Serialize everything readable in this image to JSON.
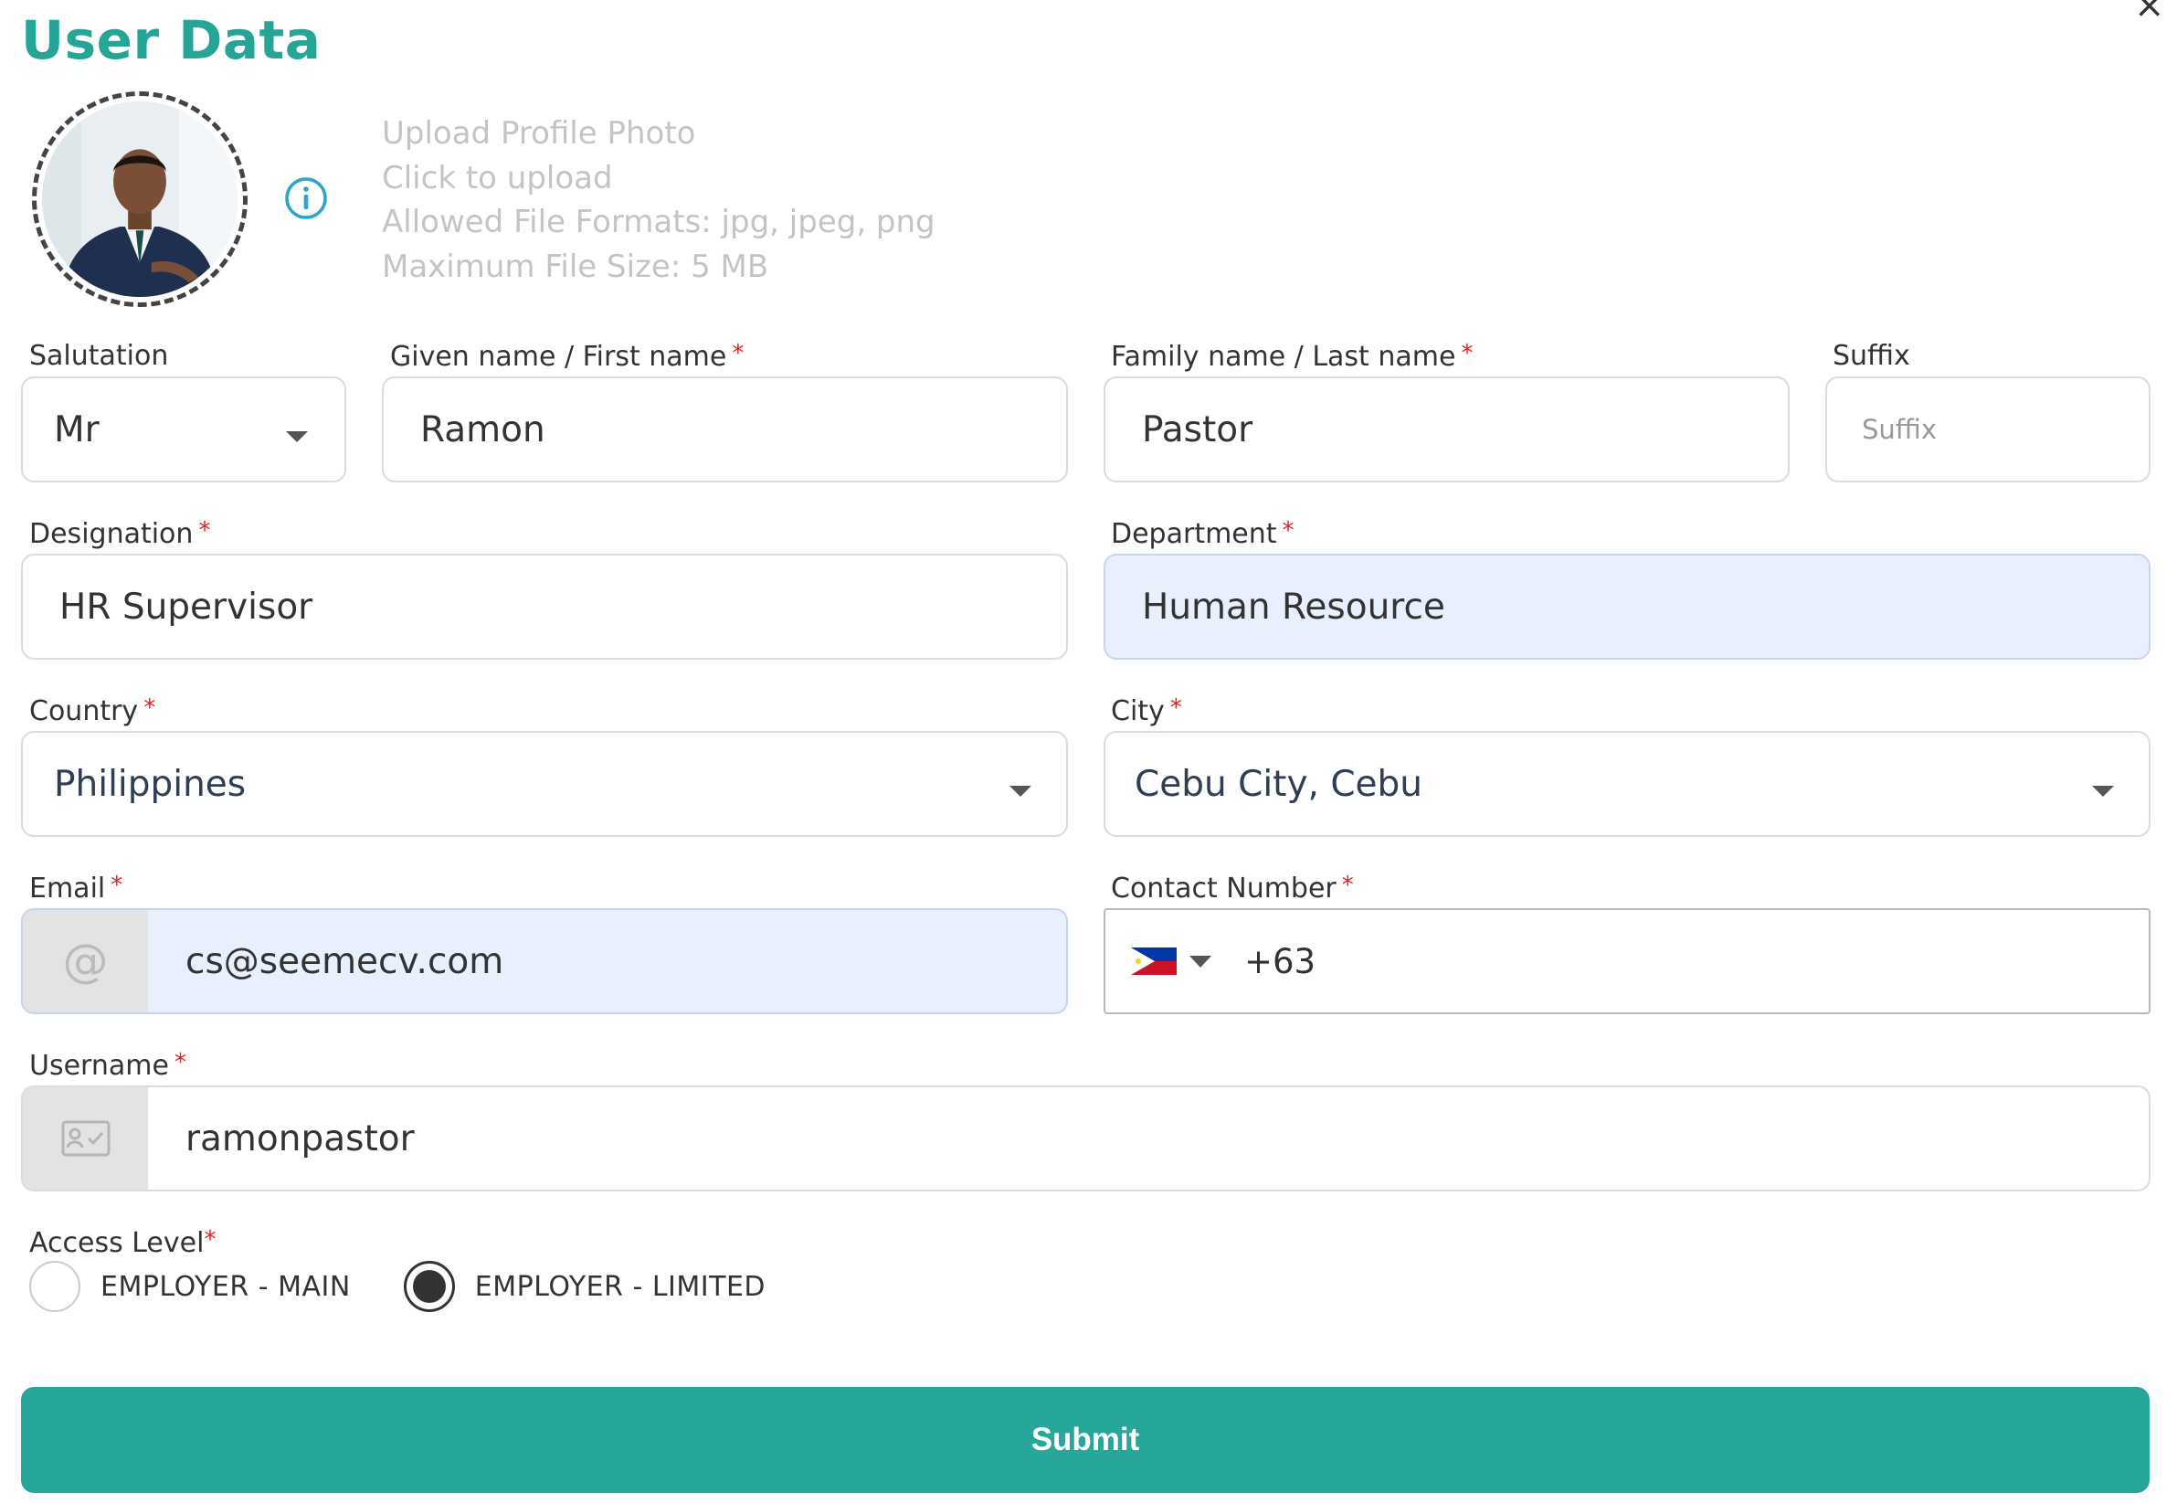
{
  "header": {
    "title": "User Data",
    "close_label": "×"
  },
  "upload": {
    "lines": [
      "Upload Profile Photo",
      "Click to upload",
      "Allowed File Formats: jpg, jpeg, png",
      "Maximum File Size: 5 MB"
    ]
  },
  "form": {
    "salutation": {
      "label": "Salutation",
      "value": "Mr"
    },
    "given_name": {
      "label": "Given name / First name",
      "required": "*",
      "value": "Ramon"
    },
    "family_name": {
      "label": "Family name / Last name",
      "required": "*",
      "value": "Pastor"
    },
    "suffix": {
      "label": "Suffix",
      "placeholder": "Suffix"
    },
    "designation": {
      "label": "Designation",
      "required": "*",
      "value": "HR Supervisor"
    },
    "department": {
      "label": "Department",
      "required": "*",
      "value": "Human Resource"
    },
    "country": {
      "label": "Country",
      "required": "*",
      "value": "Philippines"
    },
    "city": {
      "label": "City",
      "required": "*",
      "value": "Cebu City, Cebu"
    },
    "email": {
      "label": "Email",
      "required": "*",
      "value": "cs@seemecv.com",
      "icon": "at-icon"
    },
    "contact": {
      "label": "Contact Number",
      "required": "*",
      "value": "+63",
      "flag": "philippines-flag-icon"
    },
    "username": {
      "label": "Username",
      "required": "*",
      "value": "ramonpastor",
      "icon": "id-card-icon"
    },
    "access_level": {
      "label": "Access Level",
      "required": "*",
      "options": [
        {
          "label": "EMPLOYER - MAIN",
          "checked": false
        },
        {
          "label": "EMPLOYER - LIMITED",
          "checked": true
        }
      ]
    }
  },
  "submit_label": "Submit",
  "colors": {
    "accent": "#27a799",
    "title": "#25a596",
    "autofill_bg": "#e8f0fe",
    "required": "#e02424"
  }
}
